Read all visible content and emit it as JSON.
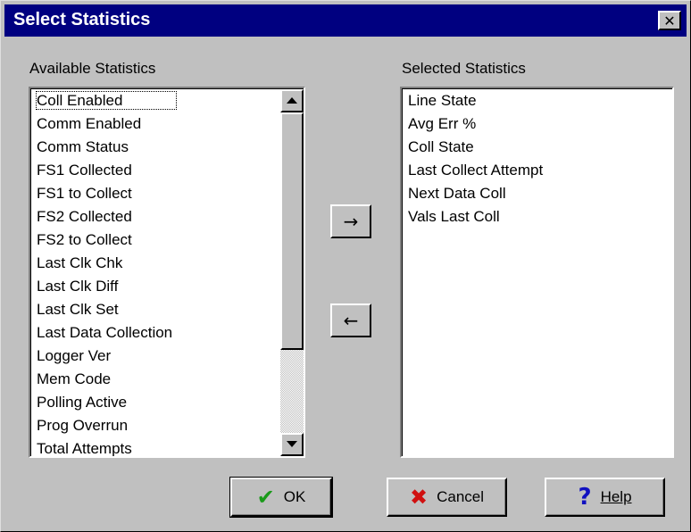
{
  "window": {
    "title": "Select Statistics",
    "close_glyph": "✕"
  },
  "available": {
    "label": "Available Statistics",
    "items": [
      "Coll Enabled",
      "Comm Enabled",
      "Comm Status",
      "FS1 Collected",
      "FS1 to Collect",
      "FS2 Collected",
      "FS2 to Collect",
      "Last Clk Chk",
      "Last Clk Diff",
      "Last Clk Set",
      "Last Data Collection",
      "Logger Ver",
      "Mem Code",
      "Polling Active",
      "Prog Overrun",
      "Total Attempts"
    ]
  },
  "selected": {
    "label": "Selected Statistics",
    "items": [
      "Line State",
      "Avg Err %",
      "Coll State",
      "Last Collect Attempt",
      "Next Data Coll",
      "Vals Last Coll"
    ]
  },
  "transfer": {
    "add_glyph": "→",
    "remove_glyph": "←"
  },
  "buttons": {
    "ok": {
      "label": "OK",
      "icon": "checkmark-icon",
      "glyph": "✔",
      "color": "#1a9a1a"
    },
    "cancel": {
      "label": "Cancel",
      "icon": "x-icon",
      "glyph": "✖",
      "color": "#d01010"
    },
    "help": {
      "label": "Help",
      "icon": "question-icon",
      "glyph": "?",
      "color": "#1010c0"
    }
  },
  "colors": {
    "titlebar": "#000080",
    "face": "#c0c0c0"
  }
}
